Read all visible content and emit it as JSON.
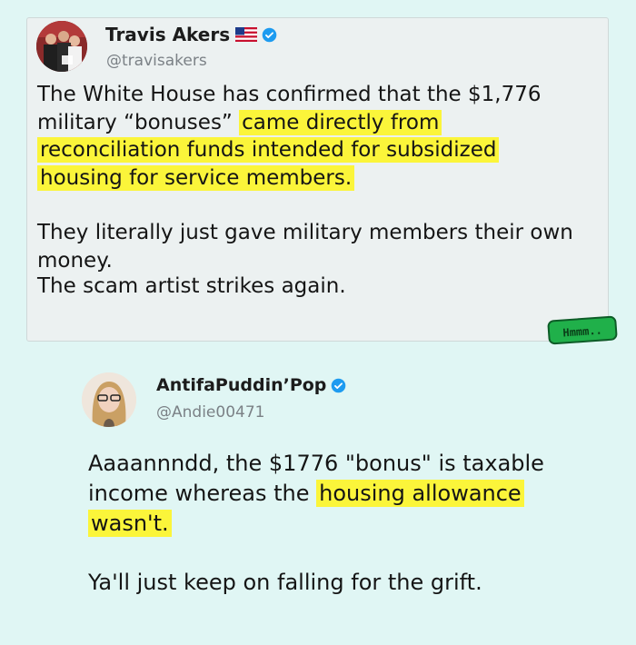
{
  "colors": {
    "background": "#e0f6f4",
    "card": "#ecf1f1",
    "highlight": "#fbf53a",
    "verified": "#1d9bf0",
    "sticker": "#20b04a"
  },
  "tweet1": {
    "display_name": "Travis Akers",
    "flag_icon": "us-flag-icon",
    "verified_icon": "verified-badge-icon",
    "handle": "@travisakers",
    "para1_part1": "The White House has confirmed that the $1,776 military “bonuses” ",
    "para1_highlight": "came directly from reconciliation funds intended for subsidized housing for service members.",
    "para2": "They literally just gave military members their own money.",
    "para3": "The scam artist strikes again."
  },
  "sticker": {
    "text": "Hmmm.."
  },
  "tweet2": {
    "display_name": "AntifaPuddin’Pop",
    "verified_icon": "verified-badge-icon",
    "handle": "@Andie00471",
    "para1_part1": "Aaaannndd, the $1776 \"bonus\" is taxable income whereas the ",
    "para1_highlight": "housing allowance wasn't.",
    "para2": "Ya'll just keep on falling for the grift."
  }
}
